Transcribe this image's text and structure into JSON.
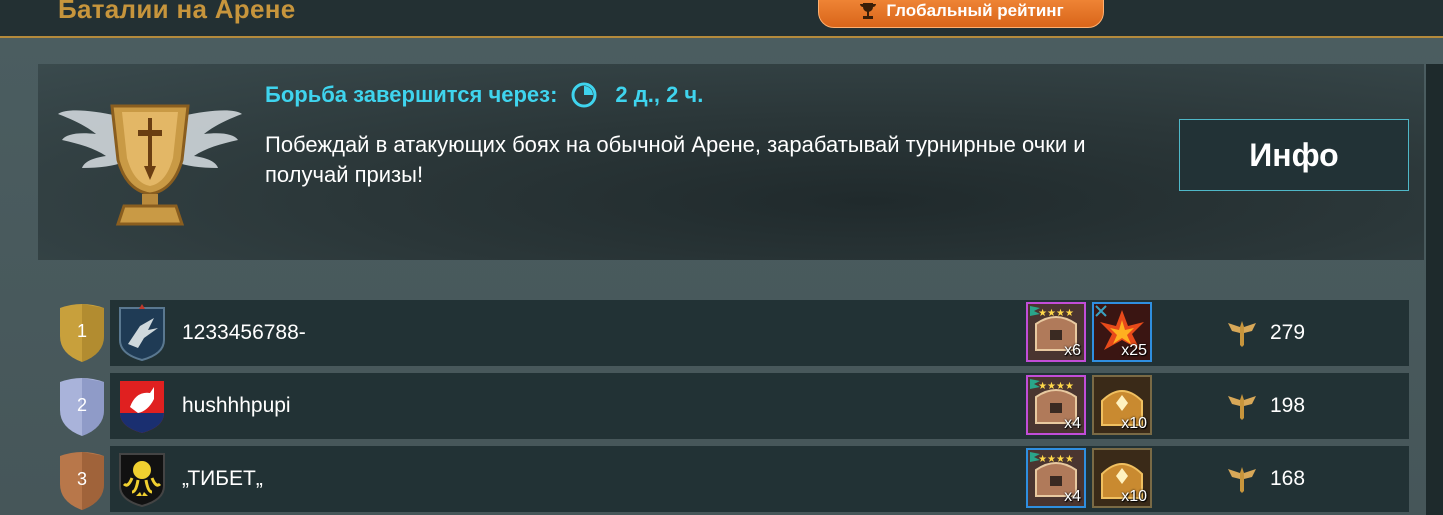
{
  "header": {
    "title": "Баталии на Арене",
    "global_rating_label": "Глобальный рейтинг"
  },
  "banner": {
    "timer_label": "Борьба завершится через:",
    "timer_value": "2 д., 2 ч.",
    "description": "Побеждай в атакующих боях на обычной Арене, зарабатывай турнирные очки и получай призы!",
    "info_button": "Инфо"
  },
  "leaderboard": [
    {
      "rank": "1",
      "name": "1233456788-",
      "points": "279",
      "clan_icon": "eagle-emblem-icon",
      "rewards": [
        {
          "icon": "purple-chest-icon",
          "count": "x6",
          "frame": "purple"
        },
        {
          "icon": "red-shard-icon",
          "count": "x25",
          "frame": "blue"
        }
      ]
    },
    {
      "rank": "2",
      "name": "hushhhpupi",
      "points": "198",
      "clan_icon": "wolf-emblem-icon",
      "rewards": [
        {
          "icon": "purple-chest-icon",
          "count": "x4",
          "frame": "purple"
        },
        {
          "icon": "gold-chest-icon",
          "count": "x10",
          "frame": "gold"
        }
      ]
    },
    {
      "rank": "3",
      "name": "„ТИБЕТ„",
      "points": "168",
      "clan_icon": "octopus-emblem-icon",
      "rewards": [
        {
          "icon": "blue-chest-icon",
          "count": "x4",
          "frame": "blue"
        },
        {
          "icon": "gold-chest-icon",
          "count": "x10",
          "frame": "gold"
        }
      ]
    }
  ],
  "colors": {
    "accent_cyan": "#3fd4ee",
    "title_gold": "#c7953c",
    "button_orange": "#e8762a",
    "row_bg": "#223235"
  }
}
